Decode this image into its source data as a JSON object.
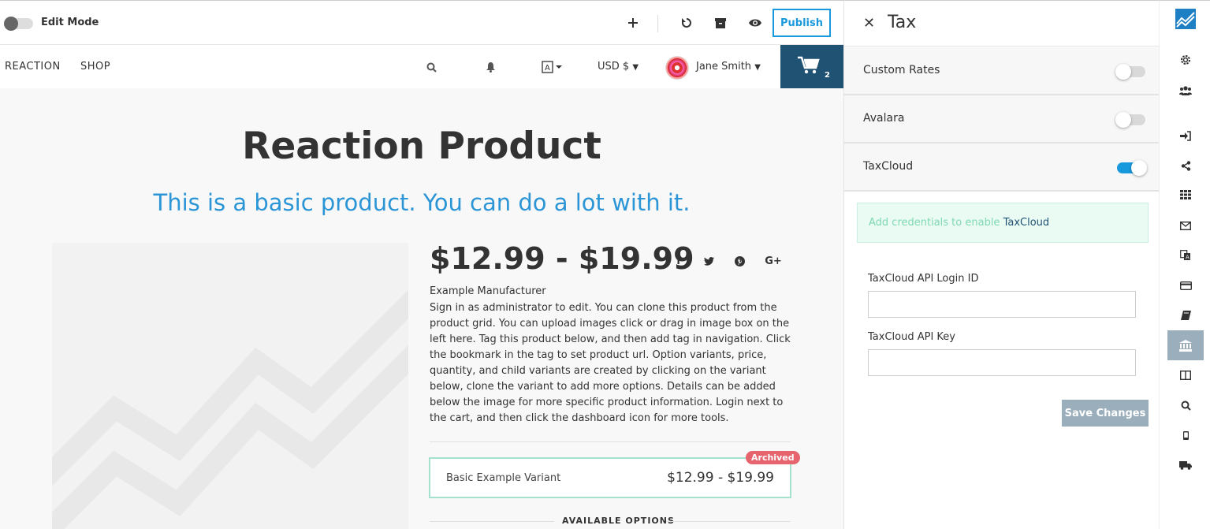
{
  "toolbar": {
    "edit_mode_label": "Edit Mode",
    "publish_label": "Publish",
    "icons": [
      "plus-icon",
      "undo-icon",
      "archive-icon",
      "eye-icon"
    ]
  },
  "nav": {
    "links": [
      "REACTION",
      "SHOP"
    ],
    "currency": "USD $",
    "user_name": "Jane Smith",
    "cart_count": "2"
  },
  "product": {
    "title": "Reaction Product",
    "subtitle": "This is a basic product. You can do a lot with it.",
    "price_range": "$12.99 - $19.99",
    "social": [
      "f",
      "t",
      "p",
      "G+"
    ],
    "manufacturer": "Example Manufacturer",
    "description": "Sign in as administrator to edit. You can clone this product from the product grid. You can upload images click or drag in image box on the left here. Tag this product below, and then add tag in navigation. Click the bookmark in the tag to set product url. Option variants, price, quantity, and child variants are created by clicking on the variant below, clone the variant to add more options. Details can be added below the image for more specific product information. Login next to the cart, and then click the dashboard icon for more tools.",
    "variant": {
      "badge": "Archived",
      "name": "Basic Example Variant",
      "price": "$12.99 - $19.99"
    },
    "options_label": "AVAILABLE OPTIONS"
  },
  "panel": {
    "title": "Tax",
    "providers": [
      {
        "label": "Custom Rates",
        "enabled": false
      },
      {
        "label": "Avalara",
        "enabled": false
      },
      {
        "label": "TaxCloud",
        "enabled": true
      }
    ],
    "alert_prefix": "Add credentials to enable ",
    "alert_provider": "TaxCloud",
    "fields": {
      "login_id_label": "TaxCloud API Login ID",
      "login_id_value": "",
      "api_key_label": "TaxCloud API Key",
      "api_key_value": ""
    },
    "save_label": "Save Changes"
  },
  "colors": {
    "accent": "#1999dd",
    "cart_bg": "#1f5273",
    "badge": "#e5646e",
    "save_button": "#9aaebb"
  }
}
